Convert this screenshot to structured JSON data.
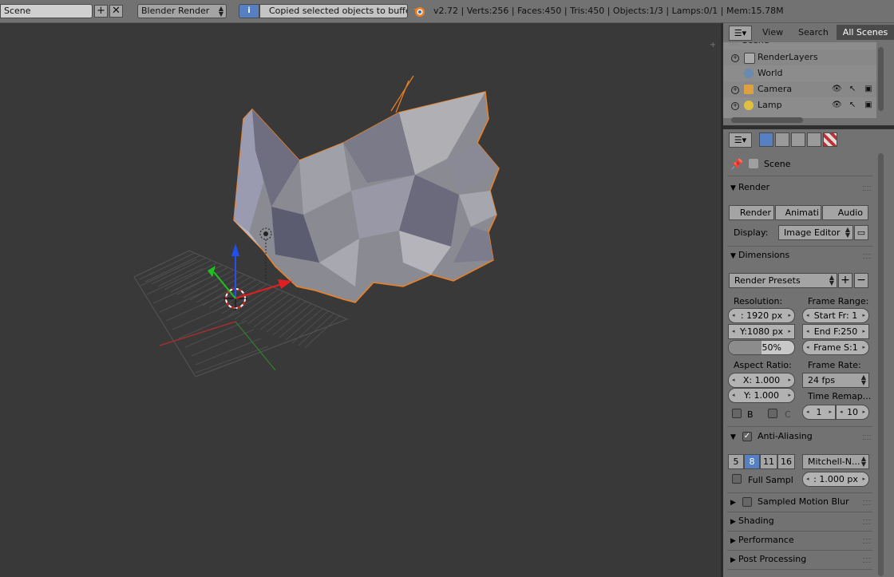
{
  "header": {
    "scene_name": "Scene",
    "renderer": "Blender Render",
    "report_message": "Copied selected objects to buffer",
    "stats": "v2.72 | Verts:256 | Faces:450 | Tris:450 | Objects:1/3 | Lamps:0/1 | Mem:15.78M"
  },
  "outliner": {
    "view_label": "View",
    "search_label": "Search",
    "filter_label": "All Scenes",
    "items": [
      {
        "label": "Scene"
      },
      {
        "label": "RenderLayers"
      },
      {
        "label": "World"
      },
      {
        "label": "Camera"
      },
      {
        "label": "Lamp"
      }
    ]
  },
  "properties": {
    "context": "Scene",
    "render_panel": {
      "title": "Render",
      "render_btn": "Render",
      "animation_btn": "Animati",
      "audio_btn": "Audio",
      "display_label": "Display:",
      "display_value": "Image Editor"
    },
    "dimensions_panel": {
      "title": "Dimensions",
      "presets": "Render Presets",
      "resolution_label": "Resolution:",
      "res_x": ": 1920 px",
      "res_y": "Y:1080 px",
      "res_pct": "50%",
      "res_pct_value": 50,
      "frame_range_label": "Frame Range:",
      "start": "Start Fr:  1",
      "end": "End F:250",
      "step": "Frame S:1",
      "aspect_label": "Aspect Ratio:",
      "aspect_x": "X:   1.000",
      "aspect_y": "Y:   1.000",
      "frame_rate_label": "Frame Rate:",
      "fps": "24 fps",
      "time_remap_label": "Time Remap...",
      "remap_old": "1",
      "remap_new": "10",
      "border_label": "B",
      "crop_label": "C"
    },
    "aa_panel": {
      "title": "Anti-Aliasing",
      "samples": [
        "5",
        "8",
        "11",
        "16"
      ],
      "selected_sample": "8",
      "filter": "Mitchell-N...",
      "full_sample_label": "Full Sampl",
      "filter_size": ": 1.000 px"
    },
    "collapsed_panels": [
      "Sampled Motion Blur",
      "Shading",
      "Performance",
      "Post Processing"
    ]
  },
  "colors": {
    "accent": "#5680c2",
    "selection_outline": "#f08020",
    "x_axis": "#e02020",
    "y_axis": "#20c020",
    "z_axis": "#2050f0"
  }
}
